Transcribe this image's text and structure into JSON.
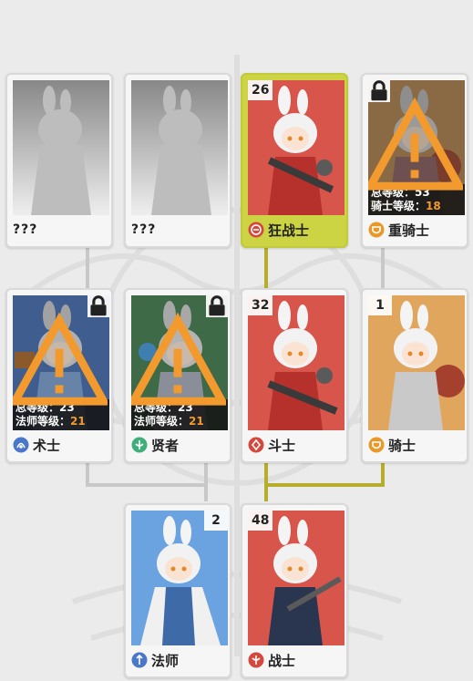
{
  "colors": {
    "background": "#ebebeb",
    "selected_card": "#cdd443",
    "active_path": "#b5ae2a",
    "inactive_path": "#c8c8c8",
    "requirement": "#f29a2e"
  },
  "cards": [
    {
      "id": "unknown-1",
      "label": "???",
      "level": null,
      "locked": false,
      "selected": false,
      "portrait": "silhouette",
      "icon": "none"
    },
    {
      "id": "unknown-2",
      "label": "???",
      "level": null,
      "locked": false,
      "selected": false,
      "portrait": "silhouette",
      "icon": "none"
    },
    {
      "id": "berserker",
      "label": "狂战士",
      "level": "26",
      "locked": false,
      "selected": true,
      "portrait": "red",
      "icon": "berserker-icon"
    },
    {
      "id": "heavy-knight",
      "label": "重骑士",
      "level": null,
      "locked": true,
      "selected": false,
      "portrait": "brown",
      "icon": "knight-icon",
      "stats": {
        "total_label": "总等级：",
        "total_value": "53",
        "req_label": "骑士等级：",
        "req_value": "18"
      }
    },
    {
      "id": "warlock",
      "label": "术士",
      "level": null,
      "locked": true,
      "selected": false,
      "portrait": "blue-dark",
      "icon": "warlock-icon",
      "stats": {
        "total_label": "总等级：",
        "total_value": "23",
        "req_label": "法师等级：",
        "req_value": "21"
      }
    },
    {
      "id": "sage",
      "label": "贤者",
      "level": null,
      "locked": true,
      "selected": false,
      "portrait": "green",
      "icon": "sage-icon",
      "stats": {
        "total_label": "总等级：",
        "total_value": "23",
        "req_label": "法师等级：",
        "req_value": "21"
      }
    },
    {
      "id": "fighter",
      "label": "斗士",
      "level": "32",
      "locked": false,
      "selected": false,
      "portrait": "red",
      "icon": "fighter-icon"
    },
    {
      "id": "knight",
      "label": "骑士",
      "level": "1",
      "locked": false,
      "selected": false,
      "portrait": "orange",
      "icon": "knight-icon"
    },
    {
      "id": "mage",
      "label": "法师",
      "level": "2",
      "locked": false,
      "selected": false,
      "portrait": "blue",
      "icon": "mage-icon"
    },
    {
      "id": "warrior",
      "label": "战士",
      "level": "48",
      "locked": false,
      "selected": false,
      "portrait": "red",
      "icon": "warrior-icon"
    }
  ]
}
